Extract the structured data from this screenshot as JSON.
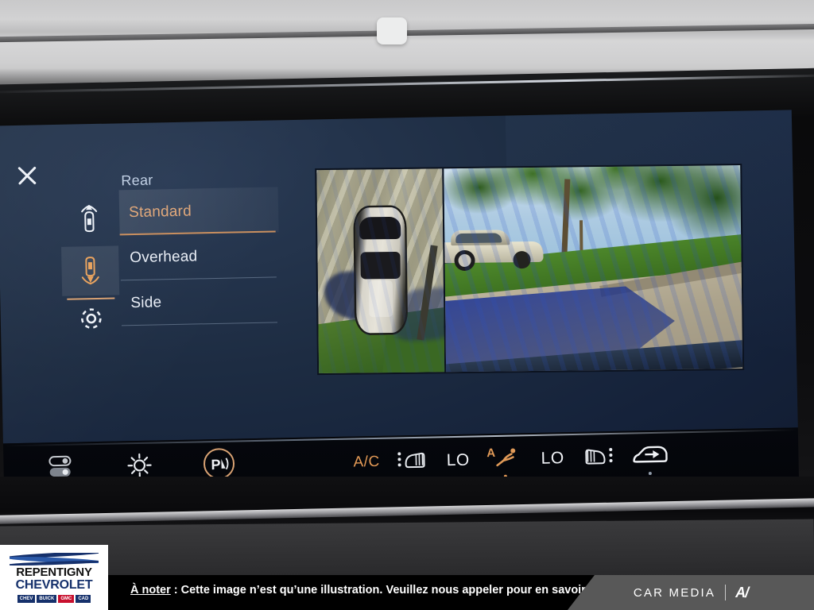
{
  "screen": {
    "close_icon": "close-x-icon",
    "header_title": "Rear",
    "rail": [
      {
        "icon": "car-front-view-icon",
        "selected": false
      },
      {
        "icon": "car-rear-view-icon",
        "selected": true
      },
      {
        "icon": "gear-settings-icon",
        "selected": false
      }
    ],
    "menu_items": [
      {
        "label": "Standard",
        "selected": true
      },
      {
        "label": "Overhead",
        "selected": false
      },
      {
        "label": "Side",
        "selected": false
      }
    ],
    "camera_views": [
      {
        "name": "overhead-birdseye-view"
      },
      {
        "name": "rear-camera-view"
      }
    ]
  },
  "controls": {
    "left": [
      {
        "icon": "toggle-switches-icon",
        "label": ""
      },
      {
        "icon": "brightness-sun-icon",
        "label": ""
      },
      {
        "icon": "park-assist-icon",
        "label": "P"
      }
    ],
    "climate": [
      {
        "icon": "ac-label",
        "label": "A/C",
        "indicator": true
      },
      {
        "icon": "driver-seat-heat-icon",
        "label": ""
      },
      {
        "icon": "driver-temp-label",
        "label": "LO"
      },
      {
        "icon": "auto-airflow-seat-icon",
        "label": "A",
        "indicator": true
      },
      {
        "icon": "passenger-temp-label",
        "label": "LO"
      },
      {
        "icon": "passenger-seat-heat-icon",
        "label": ""
      },
      {
        "icon": "air-recirculation-icon",
        "label": "",
        "indicator": true
      }
    ]
  },
  "dealer_logo": {
    "line1": "REPENTIGNY",
    "line2": "CHEVROLET",
    "brands": [
      "CHEVROLET",
      "BUICK",
      "GMC",
      "CADILLAC"
    ],
    "brand_short": [
      "CHEV",
      "BUICK",
      "GMC",
      "CAD"
    ]
  },
  "disclaimer": {
    "lead": "À noter",
    "body": " : Cette image n’est qu’une illustration. Veuillez nous appeler pour en savoir plus."
  },
  "branding": {
    "car_media": "CAR MEDIA",
    "av_logo": "A/"
  },
  "colors": {
    "accent_amber": "#e0a87b",
    "screen_navy": "#1d2c42",
    "text_light": "#e9eef6",
    "header_blue": "#c3d2e6"
  }
}
